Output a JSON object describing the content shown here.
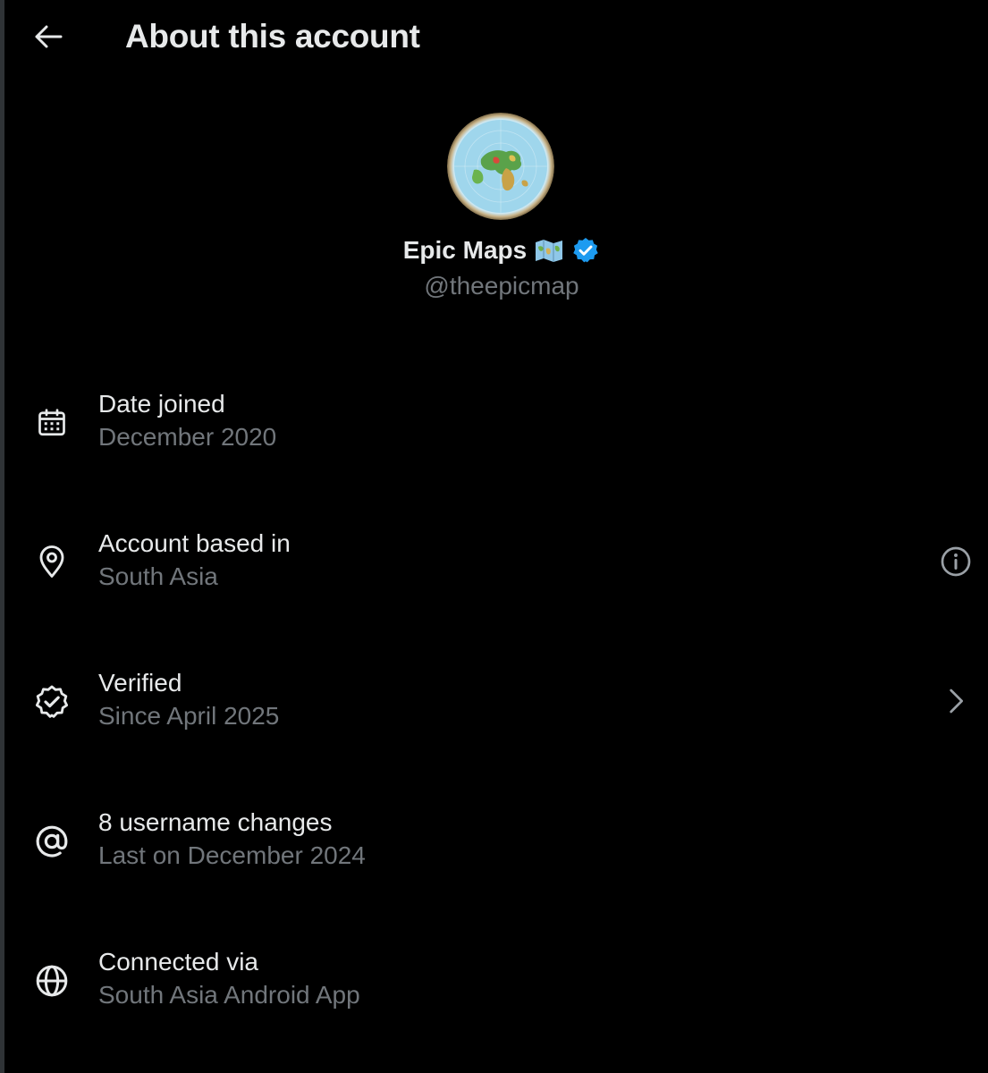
{
  "header": {
    "title": "About this account",
    "back_icon": "arrow-left-icon"
  },
  "profile": {
    "display_name": "Epic Maps",
    "name_emoji_icon": "world-map-icon",
    "verified_icon": "verified-badge-icon",
    "handle": "@theepicmap",
    "avatar_icon": "globe-map-avatar"
  },
  "rows": [
    {
      "icon": "calendar-icon",
      "label": "Date joined",
      "value": "December 2020"
    },
    {
      "icon": "location-pin-icon",
      "label": "Account based in",
      "value": "South Asia",
      "trailing": "info-icon"
    },
    {
      "icon": "verified-check-icon",
      "label": "Verified",
      "value": "Since April 2025",
      "trailing": "chevron-right-icon"
    },
    {
      "icon": "at-sign-icon",
      "label": "8 username changes",
      "value": "Last on December 2024"
    },
    {
      "icon": "globe-icon",
      "label": "Connected via",
      "value": "South Asia Android App"
    }
  ],
  "colors": {
    "background": "#000000",
    "primary_text": "#e7e9ea",
    "secondary_text": "#71767b",
    "verified_blue": "#1d9bf0"
  }
}
